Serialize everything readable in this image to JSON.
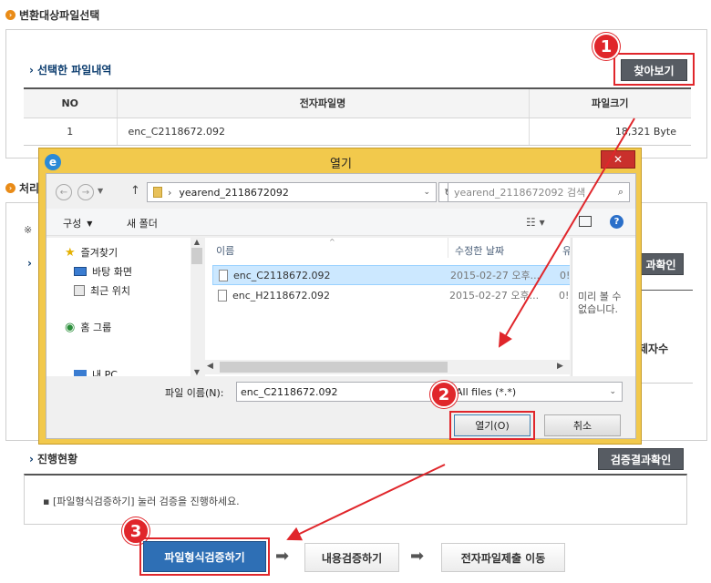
{
  "section1": {
    "title": "변환대상파일선택",
    "sub_title": "선택한 파일내역",
    "browse_label": "찾아보기"
  },
  "file_table": {
    "headers": [
      "NO",
      "전자파일명",
      "파일크기"
    ],
    "rows": [
      {
        "no": "1",
        "name": "enc_C2118672.092",
        "size": "18,321 Byte"
      }
    ]
  },
  "section2": {
    "title": "처리",
    "note_prefix": "※",
    "peek_right": "과확인",
    "peek_right2": "제자수"
  },
  "dialog": {
    "title": "열기",
    "path": "yearend_2118672092",
    "search_placeholder": "yearend_2118672092 검색",
    "organize": "구성",
    "new_folder": "새 폴더",
    "nav": [
      {
        "label": "즐겨찾기",
        "icon": "star-icon"
      },
      {
        "label": "바탕 화면",
        "icon": "desktop-icon"
      },
      {
        "label": "최근 위치",
        "icon": "recent-icon"
      },
      {
        "label": "홈 그룹",
        "icon": "homegroup-icon"
      },
      {
        "label": "내 PC",
        "icon": "pc-icon"
      }
    ],
    "columns": {
      "name": "이름",
      "modified": "수정한 날짜",
      "type": "유"
    },
    "files": [
      {
        "name": "enc_C2118672.092",
        "date": "2015-02-27 오후...",
        "extra": "0!",
        "selected": true
      },
      {
        "name": "enc_H2118672.092",
        "date": "2015-02-27 오후...",
        "extra": "0!",
        "selected": false
      }
    ],
    "preview": "미리 볼 수\n없습니다.",
    "filename_label": "파일 이름(N):",
    "filename_value": "enc_C2118672.092",
    "filter_value": "All files (*.*)",
    "open_label": "열기(O)",
    "cancel_label": "취소"
  },
  "section3": {
    "sub_title": "진행현황",
    "verify_result": "검증결과확인",
    "message": "[파일형식검증하기] 눌러 검증을 진행하세요."
  },
  "steps": [
    {
      "label": "파일형식검증하기",
      "active": true
    },
    {
      "label": "내용검증하기",
      "active": false
    },
    {
      "label": "전자파일제출 이동",
      "active": false
    }
  ],
  "markers": [
    "1",
    "2",
    "3"
  ],
  "colors": {
    "accent_red": "#e0262b",
    "dialog_frame": "#f2c94c",
    "button_dark": "#575c63",
    "step_active": "#2e6fb5"
  }
}
